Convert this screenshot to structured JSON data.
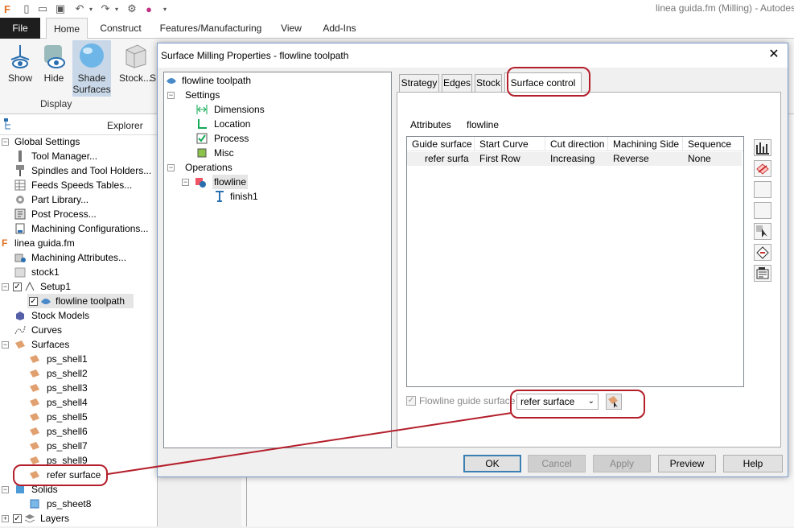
{
  "titlebar": {
    "title": "linea guida.fm (Milling) - Autodes"
  },
  "ribbon": {
    "tabs": [
      "File",
      "Home",
      "Construct",
      "Features/Manufacturing",
      "View",
      "Add-Ins"
    ],
    "buttons": [
      {
        "label": "Show"
      },
      {
        "label": "Hide"
      },
      {
        "label": "Shade Surfaces"
      },
      {
        "label": "Stock..."
      },
      {
        "label": "S"
      }
    ],
    "group_label": "Display"
  },
  "explorer": {
    "title": "Explorer",
    "items": [
      {
        "label": "Global Settings"
      },
      {
        "label": "Tool Manager..."
      },
      {
        "label": "Spindles and Tool Holders..."
      },
      {
        "label": "Feeds  Speeds Tables..."
      },
      {
        "label": "Part Library..."
      },
      {
        "label": "Post Process..."
      },
      {
        "label": "Machining Configurations..."
      },
      {
        "label": "linea guida.fm"
      },
      {
        "label": "Machining Attributes..."
      },
      {
        "label": "stock1"
      },
      {
        "label": "Setup1"
      },
      {
        "label": "flowline toolpath"
      },
      {
        "label": "Stock Models"
      },
      {
        "label": "Curves"
      },
      {
        "label": "Surfaces"
      },
      {
        "label": "ps_shell1"
      },
      {
        "label": "ps_shell2"
      },
      {
        "label": "ps_shell3"
      },
      {
        "label": "ps_shell4"
      },
      {
        "label": "ps_shell5"
      },
      {
        "label": "ps_shell6"
      },
      {
        "label": "ps_shell7"
      },
      {
        "label": "ps_shell9"
      },
      {
        "label": "refer surface"
      },
      {
        "label": "Solids"
      },
      {
        "label": "ps_sheet8"
      },
      {
        "label": "Layers"
      }
    ]
  },
  "dialog": {
    "title": "Surface Milling Properties - flowline toolpath",
    "tree": {
      "root": "flowline toolpath",
      "settings": "Settings",
      "settings_items": [
        "Dimensions",
        "Location",
        "Process",
        "Misc"
      ],
      "operations": "Operations",
      "op": "flowline",
      "finish": "finish1"
    },
    "tabs": [
      "Strategy",
      "Edges",
      "Stock",
      "Surface control"
    ],
    "attributes_label": "Attributes",
    "attributes_value": "flowline",
    "columns": [
      "Guide surface",
      "Start Curve",
      "Cut direction",
      "Machining Side",
      "Sequence"
    ],
    "rows": [
      [
        "refer surfa",
        "First Row",
        "Increasing",
        "Reverse",
        "None"
      ]
    ],
    "flowline_label": "Flowline guide surface",
    "flowline_checked": true,
    "guide_select": "refer surface",
    "buttons": {
      "ok": "OK",
      "cancel": "Cancel",
      "apply": "Apply",
      "preview": "Preview",
      "help": "Help"
    }
  },
  "colors": {
    "highlight": "#b41e2b",
    "accent": "#3c7fb1"
  }
}
